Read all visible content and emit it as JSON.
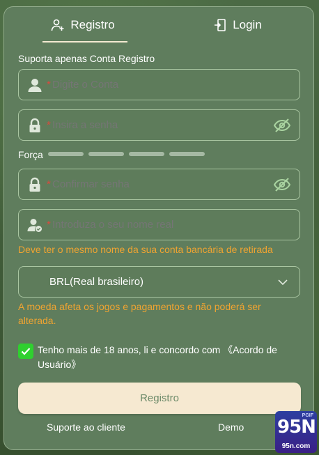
{
  "tabs": {
    "registro": "Registro",
    "login": "Login"
  },
  "form": {
    "hint": "Suporta apenas Conta Registro",
    "required_mark": "*",
    "account_placeholder": "Digite o Conta",
    "password_placeholder": "Insira a senha",
    "strength_label": "Força",
    "confirm_placeholder": "Confirmar senha",
    "realname_placeholder": "Introduza o seu nome real",
    "realname_warning": "Deve ter o mesmo nome da sua conta bancária de retirada",
    "currency_value": "BRL(Real brasileiro)",
    "currency_warning": "A moeda afeta os jogos e pagamentos e não poderá ser alterada.",
    "agree_text": "Tenho mais de 18 anos, li e concordo com 《Acordo de Usuário》",
    "agree_checked": true,
    "submit_label": "Registro"
  },
  "footer": {
    "support": "Suporte ao cliente",
    "demo": "Demo"
  },
  "brand": {
    "top": "PGIF",
    "name": "95N",
    "domain": "95n.com"
  },
  "colors": {
    "panel": "#5f7d5d",
    "border": "#aac6a2",
    "placeholder": "#a9d3a0",
    "warning": "#f0a431",
    "required": "#d84a3e",
    "checkbox": "#2fd02f",
    "submit_bg": "#f6e9d1"
  },
  "icons": {
    "registro_tab": "add-user-icon",
    "login_tab": "login-door-icon",
    "account": "user-icon",
    "password": "lock-icon",
    "visibility": "eye-off-icon",
    "realname": "user-verified-icon",
    "currency": "chevron-down-icon",
    "checkbox": "check-icon"
  }
}
